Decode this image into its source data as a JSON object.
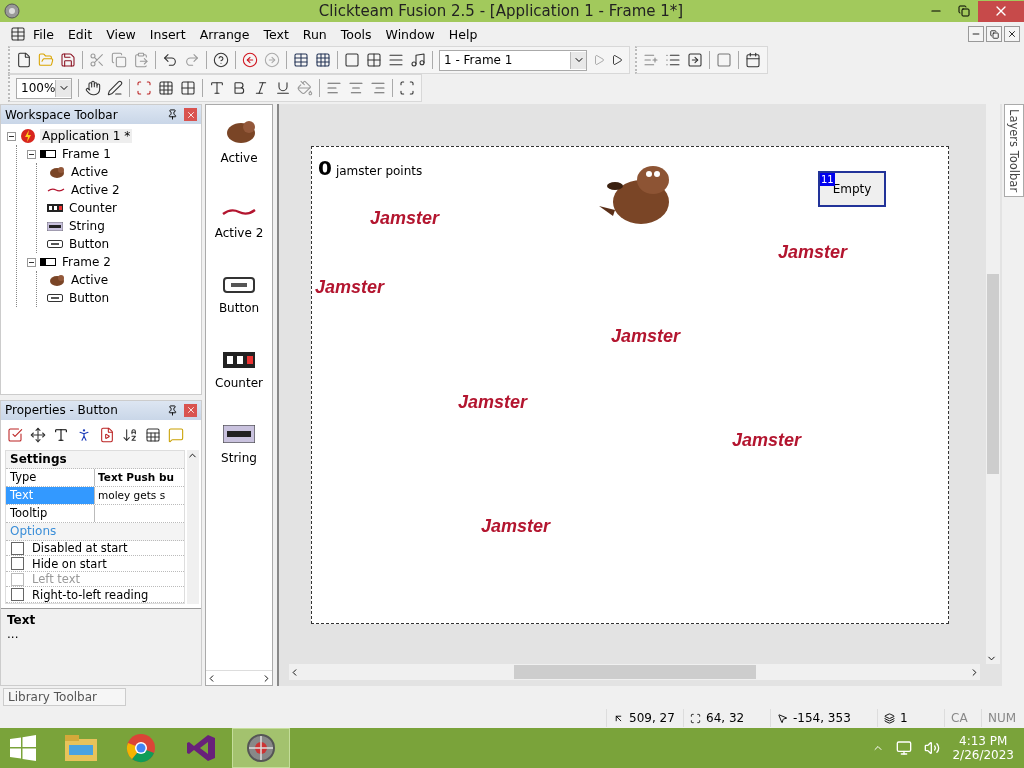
{
  "window": {
    "title": "Clickteam Fusion 2.5 - [Application 1 - Frame 1*]"
  },
  "menu": [
    "File",
    "Edit",
    "View",
    "Insert",
    "Arrange",
    "Text",
    "Run",
    "Tools",
    "Window",
    "Help"
  ],
  "frame_selector": {
    "value": "1 - Frame 1"
  },
  "zoom": {
    "value": "100%"
  },
  "workspace": {
    "title": "Workspace Toolbar",
    "tree": [
      {
        "label": "Application 1 *",
        "kind": "application",
        "expanded": true,
        "children": [
          {
            "label": "Frame 1",
            "kind": "frame",
            "expanded": true,
            "children": [
              {
                "label": "Active",
                "kind": "active"
              },
              {
                "label": "Active 2",
                "kind": "active2"
              },
              {
                "label": "Counter",
                "kind": "counter"
              },
              {
                "label": "String",
                "kind": "string"
              },
              {
                "label": "Button",
                "kind": "button"
              }
            ]
          },
          {
            "label": "Frame 2",
            "kind": "frame",
            "expanded": true,
            "children": [
              {
                "label": "Active",
                "kind": "active"
              },
              {
                "label": "Button",
                "kind": "button"
              }
            ]
          }
        ]
      }
    ]
  },
  "properties": {
    "title": "Properties - Button",
    "sections": [
      {
        "title": "Settings",
        "kind": "settings",
        "rows": [
          {
            "name": "Type",
            "value": "Text Push bu",
            "selected": false
          },
          {
            "name": "Text",
            "value": "moley gets s",
            "selected": true
          },
          {
            "name": "Tooltip",
            "selected": false
          }
        ]
      },
      {
        "title": "Options",
        "kind": "options",
        "rows": [
          {
            "label": "Disabled at start",
            "checked": false,
            "disabled": false
          },
          {
            "label": "Hide on start",
            "checked": false,
            "disabled": false
          },
          {
            "label": "Left text",
            "checked": false,
            "disabled": true
          },
          {
            "label": "Right-to-left reading",
            "checked": false,
            "disabled": false
          }
        ]
      }
    ],
    "description": {
      "title": "Text",
      "body": "..."
    }
  },
  "objects": [
    {
      "label": "Active",
      "kind": "active"
    },
    {
      "label": "Active 2",
      "kind": "active2"
    },
    {
      "label": "Button",
      "kind": "button"
    },
    {
      "label": "Counter",
      "kind": "counter"
    },
    {
      "label": "String",
      "kind": "string"
    }
  ],
  "frame": {
    "counter": {
      "value": "0",
      "label": "jamster points"
    },
    "button": {
      "badge": "11",
      "label": "Empty"
    },
    "logos": [
      "Jamster",
      "Jamster",
      "Jamster",
      "Jamster",
      "Jamster",
      "Jamster",
      "Jamster"
    ]
  },
  "layers_tab": "Layers Toolbar",
  "library_tab": "Library Toolbar",
  "status_bar": [
    {
      "kind": "position",
      "text": "509, 27"
    },
    {
      "kind": "size",
      "text": "64, 32"
    },
    {
      "kind": "cursor",
      "text": "-154, 353"
    },
    {
      "kind": "layer",
      "text": "1"
    },
    {
      "kind": "plain",
      "text": "CA"
    },
    {
      "kind": "plain",
      "text": "NUM"
    }
  ],
  "taskbar": {
    "apps": [
      {
        "kind": "explorer",
        "selected": false
      },
      {
        "kind": "chrome",
        "selected": false
      },
      {
        "kind": "studio",
        "selected": false
      },
      {
        "kind": "fusion",
        "selected": true
      }
    ],
    "time": "4:13 PM",
    "date": "2/26/2023"
  }
}
